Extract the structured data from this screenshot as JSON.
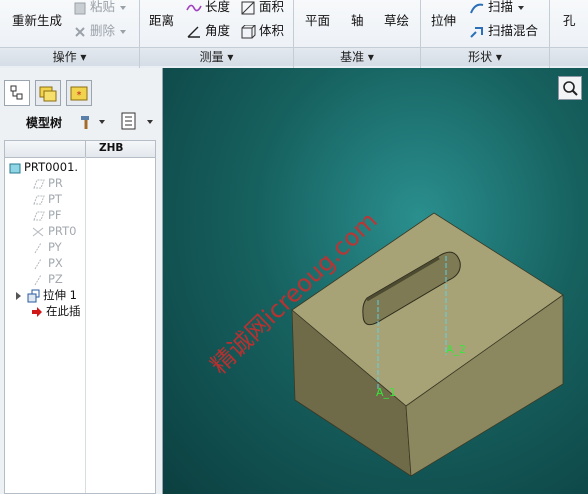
{
  "ribbon": {
    "operations": {
      "regenerate": "重新生成",
      "paste": "粘贴",
      "delete": "删除",
      "title": "操作"
    },
    "measure": {
      "distance": "距离",
      "length": "长度",
      "angle": "角度",
      "area": "面积",
      "volume": "体积",
      "title": "测量"
    },
    "datum": {
      "plane": "平面",
      "axis": "轴",
      "sketch": "草绘",
      "title": "基准"
    },
    "shapes": {
      "extrude": "拉伸",
      "sweep": "扫描",
      "swept_blend": "扫描混合",
      "title": "形状"
    },
    "engineering": {
      "hole": "孔"
    }
  },
  "panel": {
    "toolbar_label": "模型树",
    "column_header": "ZHB",
    "tree": [
      {
        "label": "PRT0001.",
        "state": "normal"
      },
      {
        "label": "PR",
        "state": "dim"
      },
      {
        "label": "PT",
        "state": "dim"
      },
      {
        "label": "PF",
        "state": "dim"
      },
      {
        "label": "PRT0",
        "state": "dim"
      },
      {
        "label": "PY",
        "state": "dim"
      },
      {
        "label": "PX",
        "state": "dim"
      },
      {
        "label": "PZ",
        "state": "dim"
      },
      {
        "label": "拉伸 1",
        "state": "normal"
      },
      {
        "label": "在此插",
        "state": "normal"
      }
    ]
  },
  "viewport": {
    "axis_labels": [
      "A_1",
      "A_2"
    ],
    "watermark": "精诚网icreoug.com"
  },
  "colors": {
    "part_top": "#a7a377",
    "part_front": "#6f6b49",
    "part_side": "#8b875e",
    "axis_line": "#5fd0e0",
    "axis_label": "#39e639",
    "watermark": "#d42a2a"
  }
}
